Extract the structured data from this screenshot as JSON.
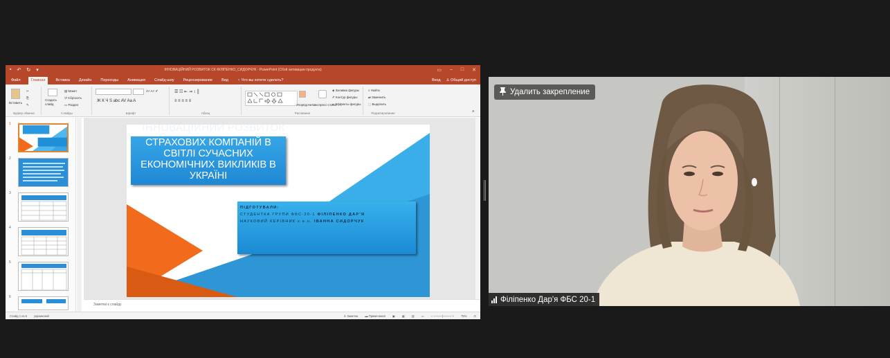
{
  "powerpoint": {
    "window_title": "ІННОВАЦІЙНИЙ РОЗВИТОК СК ФІЛІПЕНКО_СИДОРЧУК - PowerPoint (Сбой активации продукта)",
    "tabs": [
      "Файл",
      "Главная",
      "Вставка",
      "Дизайн",
      "Переходы",
      "Анимация",
      "Слайд-шоу",
      "Рецензирование",
      "Вид"
    ],
    "tell_me": "Что вы хотите сделать?",
    "signin": "Вход",
    "share": "Общий доступ",
    "ribbon": {
      "paste": "Вставить",
      "clipboard": "Буфер обмена",
      "new_slide": "Создать слайд",
      "layout": "Макет",
      "reset": "Сбросить",
      "section": "Раздел",
      "slides": "Слайды",
      "font_group": "Шрифт",
      "font_buttons": "Ж  К  Ч  S  abc  AV  Aa  A",
      "paragraph": "Абзац",
      "arrange": "Упорядочить",
      "quick_styles": "Экспресс-стили",
      "drawing": "Рисование",
      "shape_fill": "Заливка фигуры",
      "shape_outline": "Контур фигуры",
      "shape_effects": "Эффекты фигуры",
      "find": "Найти",
      "replace": "Заменить",
      "select": "Выделить",
      "editing": "Редактирование"
    },
    "slide_numbers": [
      "1",
      "2",
      "3",
      "4",
      "5",
      "6"
    ],
    "slide": {
      "title_ghost": "ІННОВАЦІЙНИЙ РОЗВИТОК",
      "title": "СТРАХОВИХ КОМПАНІЙ В СВІТЛІ СУЧАСНИХ ЕКОНОМІЧНИХ ВИКЛИКІВ В УКРАЇНІ",
      "prepared_label": "ПІДГОТУВАЛИ:",
      "student_prefix": "СТУДЕНТКА ГРУПИ ФБС-20-1 ",
      "student_name": "ФІЛІПЕНКО ДАР'Я",
      "advisor_prefix": "НАУКОВИЙ КЕРІВНИК к.е.н. ",
      "advisor_name": "ІВАННА СИДОРЧУК"
    },
    "notes_placeholder": "Заметки к слайду",
    "status": {
      "slide_info": "Слайд 1 из 6",
      "language": "украинский",
      "notes": "Заметки",
      "comments": "Примечания",
      "zoom": "75%"
    },
    "colors": {
      "accent": "#b7472a",
      "slide_blue": "#36a6e8",
      "slide_orange": "#f26a1b"
    }
  },
  "video": {
    "unpin_label": "Удалить закрепление",
    "participant_name": "Філіпенко Дар'я ФБС 20-1"
  }
}
